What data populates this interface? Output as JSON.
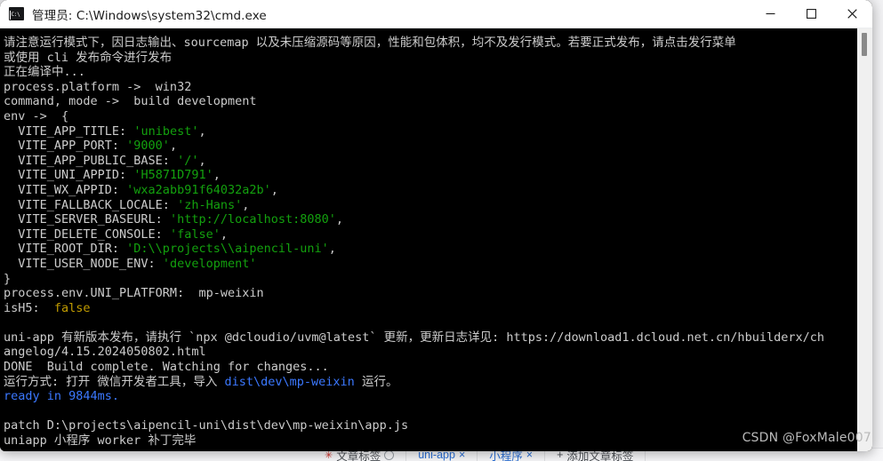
{
  "window": {
    "title": "管理员: C:\\Windows\\system32\\cmd.exe",
    "icon": "cmd-console-icon",
    "controls": {
      "minimize": "最小化",
      "maximize": "最大化",
      "close": "关闭"
    }
  },
  "console": {
    "lines": [
      {
        "segments": [
          {
            "text": "请注意运行模式下，因日志输出、sourcemap 以及未压缩源码等原因，性能和包体积，均不及发行模式。若要正式发布，请点击发行菜单",
            "color": "white"
          }
        ]
      },
      {
        "segments": [
          {
            "text": "或使用 cli 发布命令进行发布",
            "color": "white"
          }
        ]
      },
      {
        "segments": [
          {
            "text": "正在编译中...",
            "color": "white"
          }
        ]
      },
      {
        "segments": [
          {
            "text": "process.platform ->  win32",
            "color": "white"
          }
        ]
      },
      {
        "segments": [
          {
            "text": "command, mode ->  build development",
            "color": "white"
          }
        ]
      },
      {
        "segments": [
          {
            "text": "env ->  {",
            "color": "white"
          }
        ]
      },
      {
        "segments": [
          {
            "text": "  VITE_APP_TITLE: ",
            "color": "white"
          },
          {
            "text": "'unibest'",
            "color": "green"
          },
          {
            "text": ",",
            "color": "white"
          }
        ]
      },
      {
        "segments": [
          {
            "text": "  VITE_APP_PORT: ",
            "color": "white"
          },
          {
            "text": "'9000'",
            "color": "green"
          },
          {
            "text": ",",
            "color": "white"
          }
        ]
      },
      {
        "segments": [
          {
            "text": "  VITE_APP_PUBLIC_BASE: ",
            "color": "white"
          },
          {
            "text": "'/'",
            "color": "green"
          },
          {
            "text": ",",
            "color": "white"
          }
        ]
      },
      {
        "segments": [
          {
            "text": "  VITE_UNI_APPID: ",
            "color": "white"
          },
          {
            "text": "'H5871D791'",
            "color": "green"
          },
          {
            "text": ",",
            "color": "white"
          }
        ]
      },
      {
        "segments": [
          {
            "text": "  VITE_WX_APPID: ",
            "color": "white"
          },
          {
            "text": "'wxa2abb91f64032a2b'",
            "color": "green"
          },
          {
            "text": ",",
            "color": "white"
          }
        ]
      },
      {
        "segments": [
          {
            "text": "  VITE_FALLBACK_LOCALE: ",
            "color": "white"
          },
          {
            "text": "'zh-Hans'",
            "color": "green"
          },
          {
            "text": ",",
            "color": "white"
          }
        ]
      },
      {
        "segments": [
          {
            "text": "  VITE_SERVER_BASEURL: ",
            "color": "white"
          },
          {
            "text": "'http://localhost:8080'",
            "color": "green"
          },
          {
            "text": ",",
            "color": "white"
          }
        ]
      },
      {
        "segments": [
          {
            "text": "  VITE_DELETE_CONSOLE: ",
            "color": "white"
          },
          {
            "text": "'false'",
            "color": "green"
          },
          {
            "text": ",",
            "color": "white"
          }
        ]
      },
      {
        "segments": [
          {
            "text": "  VITE_ROOT_DIR: ",
            "color": "white"
          },
          {
            "text": "'D:\\\\projects\\\\aipencil-uni'",
            "color": "green"
          },
          {
            "text": ",",
            "color": "white"
          }
        ]
      },
      {
        "segments": [
          {
            "text": "  VITE_USER_NODE_ENV: ",
            "color": "white"
          },
          {
            "text": "'development'",
            "color": "green"
          }
        ]
      },
      {
        "segments": [
          {
            "text": "}",
            "color": "white"
          }
        ]
      },
      {
        "segments": [
          {
            "text": "process.env.UNI_PLATFORM:  mp-weixin",
            "color": "white"
          }
        ]
      },
      {
        "segments": [
          {
            "text": "isH5:  ",
            "color": "white"
          },
          {
            "text": "false",
            "color": "yellow"
          }
        ]
      },
      {
        "segments": [
          {
            "text": "",
            "color": "white"
          }
        ]
      },
      {
        "segments": [
          {
            "text": "uni-app 有新版本发布，请执行 `npx @dcloudio/uvm@latest` 更新，更新日志详见: https://download1.dcloud.net.cn/hbuilderx/ch",
            "color": "white"
          }
        ]
      },
      {
        "segments": [
          {
            "text": "angelog/4.15.2024050802.html",
            "color": "white"
          }
        ]
      },
      {
        "segments": [
          {
            "text": "DONE  Build complete. Watching for changes...",
            "color": "white"
          }
        ]
      },
      {
        "segments": [
          {
            "text": "运行方式: 打开 微信开发者工具，导入 ",
            "color": "white"
          },
          {
            "text": "dist\\dev\\mp-weixin",
            "color": "blue"
          },
          {
            "text": " 运行。",
            "color": "white"
          }
        ]
      },
      {
        "segments": [
          {
            "text": "ready in 9844ms.",
            "color": "blue"
          }
        ]
      },
      {
        "segments": [
          {
            "text": "",
            "color": "white"
          }
        ]
      },
      {
        "segments": [
          {
            "text": "patch D:\\projects\\aipencil-uni\\dist\\dev\\mp-weixin\\app.js",
            "color": "white"
          }
        ]
      },
      {
        "segments": [
          {
            "text": "uniapp 小程序 worker 补丁完毕",
            "color": "white"
          }
        ]
      }
    ],
    "colors": {
      "background": "#000000",
      "foreground": "#cccccc",
      "green": "#13a10e",
      "yellow": "#c19c00",
      "blue": "#3b78ff"
    },
    "scrollbar": {
      "position": "right",
      "thumb_at": "top"
    }
  },
  "watermark": {
    "text": "CSDN @FoxMale007"
  },
  "background_page": {
    "edge_char": "程",
    "toolbar_items": [
      {
        "label": "文章标签",
        "style": "plain"
      },
      {
        "label": "uni-app",
        "style": "blue"
      },
      {
        "label": "小程序",
        "style": "blue"
      },
      {
        "label": "添加文章标签",
        "style": "plain"
      }
    ]
  }
}
